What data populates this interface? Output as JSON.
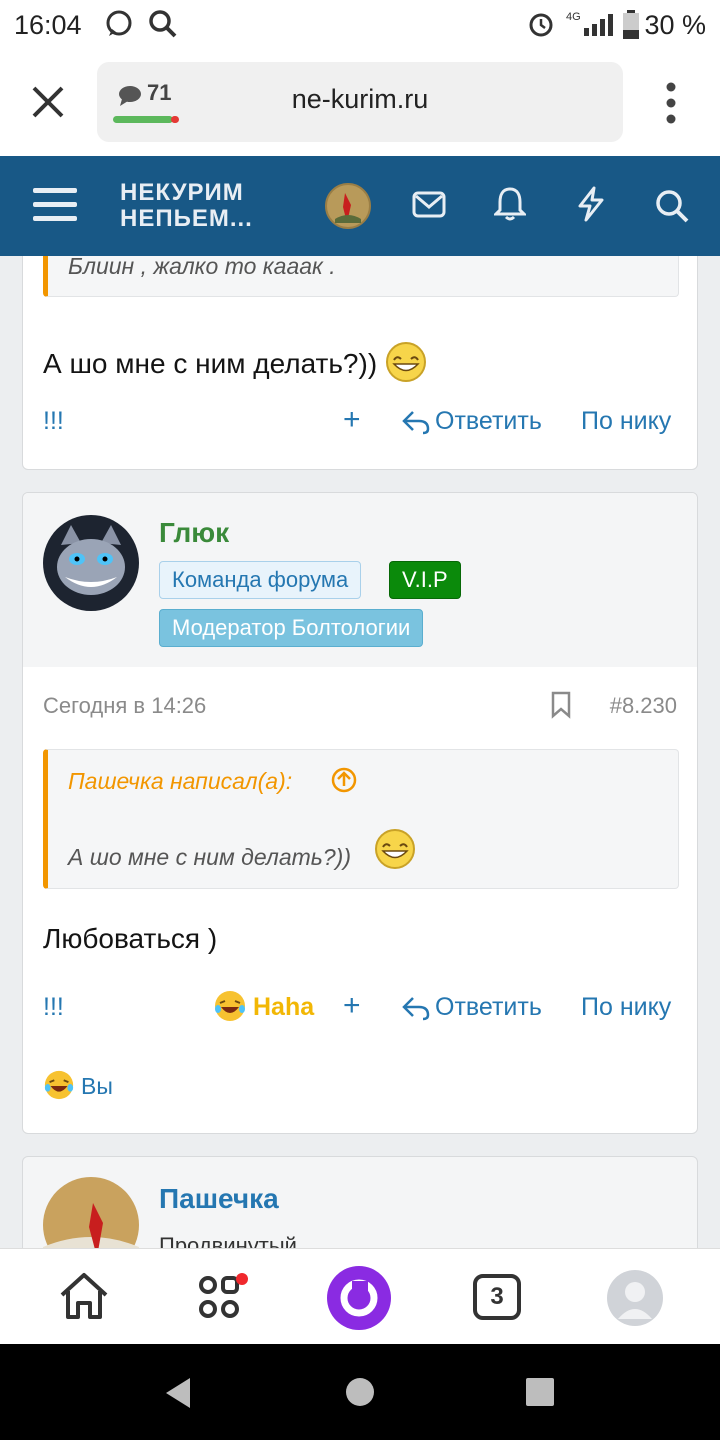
{
  "status": {
    "time": "16:04",
    "battery": "30 %",
    "network": "4G"
  },
  "browser": {
    "url": "ne-kurim.ru",
    "tab_count": "71"
  },
  "site": {
    "logo_line1": "НЕКУРИМ",
    "logo_line2": "НЕПЬЕМ..."
  },
  "post1": {
    "quote_text": "Блиин , жалко то кааак .",
    "message": "А шо мне с ним делать?))",
    "actions": {
      "react": "!!!",
      "plus": "+",
      "reply": "Ответить",
      "by_nick": "По нику"
    }
  },
  "post2": {
    "username": "Глюк",
    "badges": [
      "Команда форума",
      "V.I.P",
      "Модератор Болтологии"
    ],
    "time": "Сегодня в 14:26",
    "post_number": "#8.230",
    "quote_author": "Пашечка написал(а):",
    "quote_text": "А шо мне с ним делать?))",
    "message": "Любоваться )",
    "actions": {
      "react": "!!!",
      "reaction": "Haha",
      "plus": "+",
      "reply": "Ответить",
      "by_nick": "По нику"
    },
    "reactors": "Вы"
  },
  "post3": {
    "username": "Пашечка",
    "rank": "Продвинутый"
  },
  "bottom_nav": {
    "tabs_badge": "3"
  },
  "colors": {
    "header": "#185886",
    "link": "#2577b1",
    "quote_border": "#f29600",
    "vip": "#0b8a0b",
    "moderator": "#7ac3df",
    "username_green": "#3a8a3a"
  }
}
